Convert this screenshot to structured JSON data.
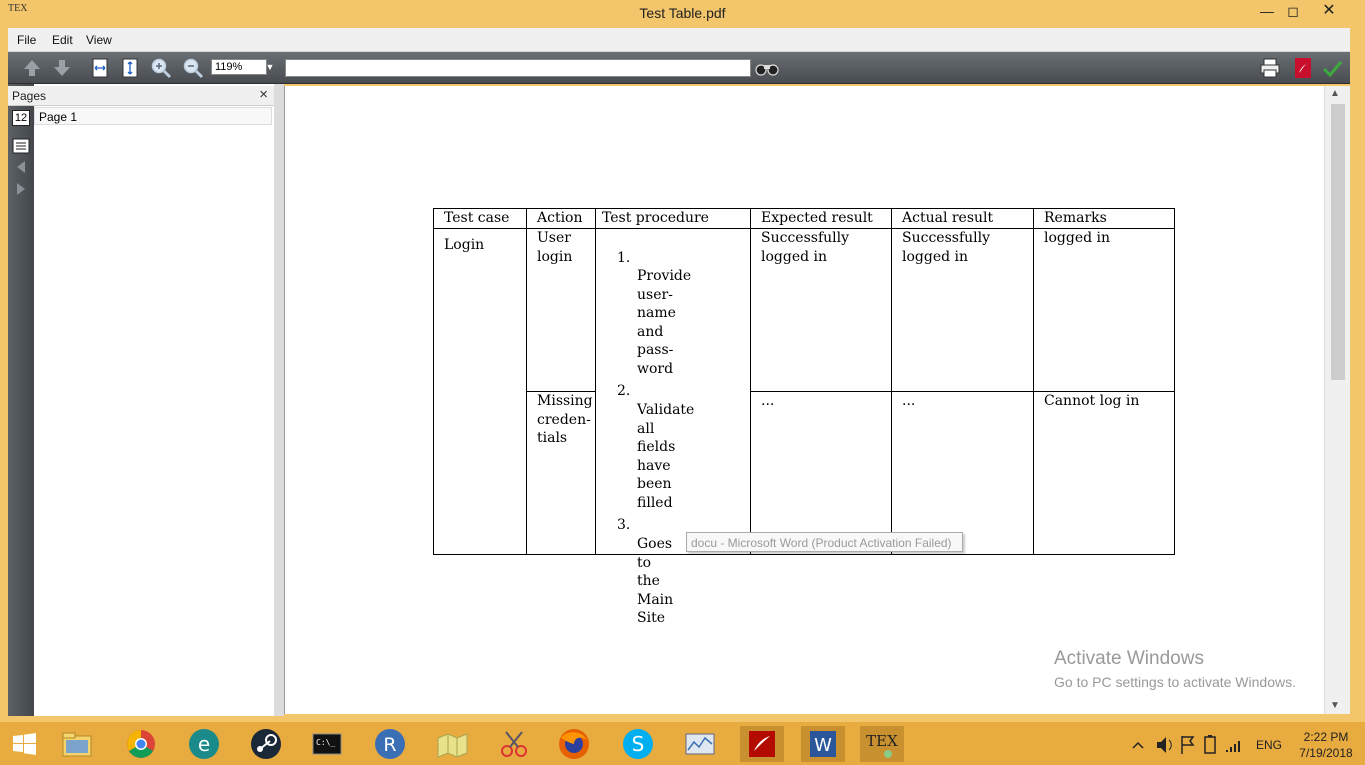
{
  "window": {
    "title": "Test Table.pdf",
    "app_icon_text": "TEX"
  },
  "menu": [
    {
      "label": "File"
    },
    {
      "label": "Edit"
    },
    {
      "label": "View"
    }
  ],
  "toolbar": {
    "zoom": "119%",
    "search_value": ""
  },
  "pages_panel": {
    "title": "Pages",
    "close": "×",
    "items": [
      {
        "label": "Page 1"
      }
    ]
  },
  "side_strip": {
    "page_icon_text": "12"
  },
  "table": {
    "headers": [
      "Test case",
      "Action",
      "Test procedure",
      "Expected result",
      "Actual result",
      "Remarks"
    ],
    "test_case": "Login",
    "rows": [
      {
        "action": [
          "User",
          "login"
        ],
        "expected": [
          "Successfully",
          "logged in"
        ],
        "actual": [
          "Successfully",
          "logged in"
        ],
        "remarks": "logged in"
      },
      {
        "action": [
          "Missing",
          "creden-",
          "tials"
        ],
        "expected": [
          "..."
        ],
        "actual": [
          "..."
        ],
        "remarks": "Cannot log in"
      }
    ],
    "procedure": [
      {
        "num": "1.",
        "lines": [
          "Provide",
          "user-",
          "name",
          "and",
          "pass-",
          "word"
        ]
      },
      {
        "num": "2.",
        "lines": [
          "Validate",
          "all",
          "fields",
          "have",
          "been",
          "filled"
        ]
      },
      {
        "num": "3.",
        "lines": [
          "Goes",
          "to",
          "the",
          "Main",
          "Site"
        ]
      }
    ]
  },
  "tooltip": "docu - Microsoft Word (Product Activation Failed)",
  "watermark": {
    "title": "Activate Windows",
    "subtitle": "Go to PC settings to activate Windows."
  },
  "tray": {
    "language": "ENG",
    "time": "2:22 PM",
    "date": "7/19/2018"
  },
  "colors": {
    "titlebar": "#f3c66c",
    "taskbar": "#e7ab40",
    "toolbar": "#555a5e"
  }
}
